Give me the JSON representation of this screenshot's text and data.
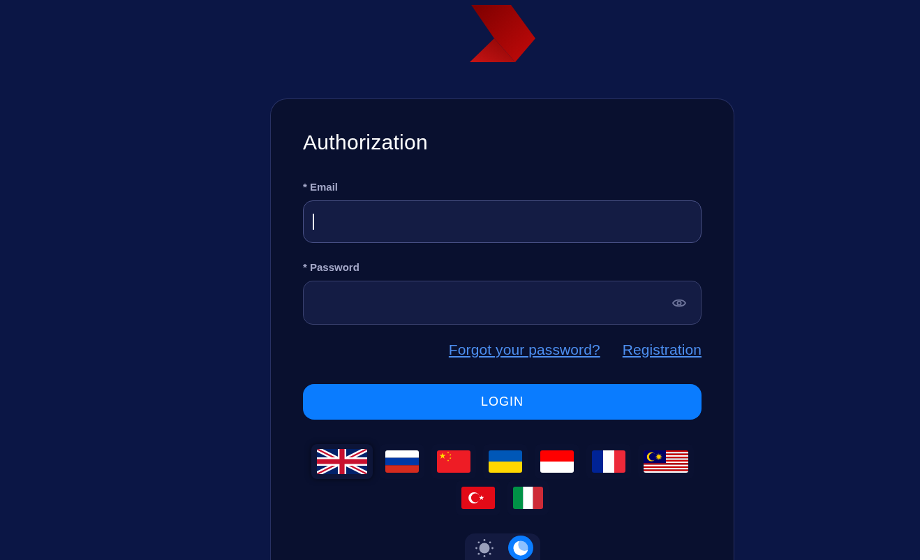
{
  "form": {
    "title": "Authorization",
    "fields": [
      {
        "kind": "email",
        "label": "* Email",
        "focused": true
      },
      {
        "kind": "password",
        "label": "* Password",
        "focused": false
      }
    ],
    "links": [
      "Forgot your password?",
      "Registration"
    ],
    "submit_button": "LOGIN",
    "languages": [
      {
        "kind": "gb",
        "selected": true
      },
      {
        "kind": "ru",
        "selected": false
      },
      {
        "kind": "cn",
        "selected": false
      },
      {
        "kind": "ua",
        "selected": false
      },
      {
        "kind": "id",
        "selected": false
      },
      {
        "kind": "fr",
        "selected": false
      },
      {
        "kind": "my",
        "selected": false
      },
      {
        "kind": "tr",
        "selected": false
      },
      {
        "kind": "it",
        "selected": false
      }
    ],
    "theme_options": [
      {
        "kind": "light",
        "selected": false
      },
      {
        "kind": "dark",
        "selected": true
      }
    ]
  }
}
